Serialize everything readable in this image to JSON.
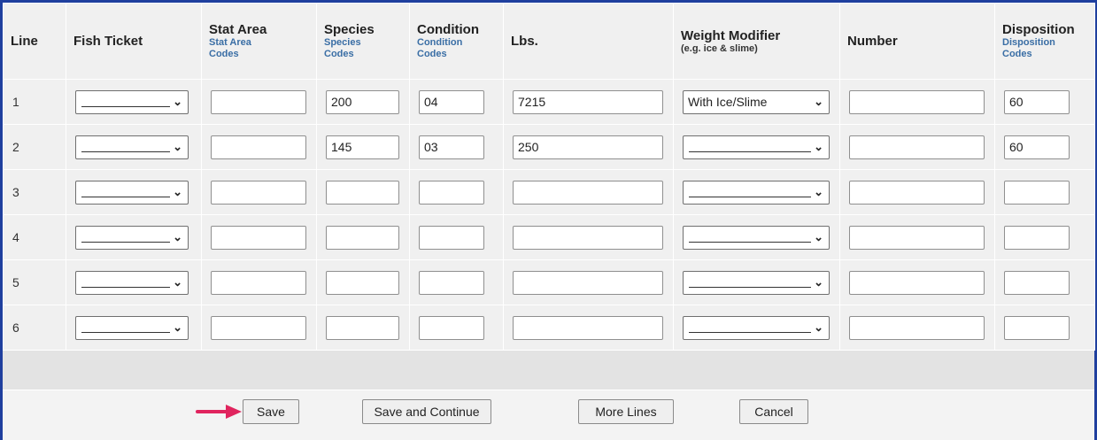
{
  "headers": {
    "line": "Line",
    "fish_ticket": "Fish Ticket",
    "stat_area": "Stat Area",
    "stat_area_link": "Stat Area Codes",
    "species": "Species",
    "species_link": "Species Codes",
    "condition": "Condition",
    "condition_link": "Condition Codes",
    "lbs": "Lbs.",
    "weight_modifier": "Weight Modifier",
    "weight_modifier_hint": "(e.g. ice & slime)",
    "number": "Number",
    "disposition": "Disposition",
    "disposition_link": "Disposition Codes"
  },
  "rows": [
    {
      "line": "1",
      "fish_ticket": "",
      "stat_area": "",
      "species": "200",
      "condition": "04",
      "lbs": "7215",
      "weight_modifier": "With Ice/Slime",
      "number": "",
      "disposition": "60"
    },
    {
      "line": "2",
      "fish_ticket": "",
      "stat_area": "",
      "species": "145",
      "condition": "03",
      "lbs": "250",
      "weight_modifier": "",
      "number": "",
      "disposition": "60"
    },
    {
      "line": "3",
      "fish_ticket": "",
      "stat_area": "",
      "species": "",
      "condition": "",
      "lbs": "",
      "weight_modifier": "",
      "number": "",
      "disposition": ""
    },
    {
      "line": "4",
      "fish_ticket": "",
      "stat_area": "",
      "species": "",
      "condition": "",
      "lbs": "",
      "weight_modifier": "",
      "number": "",
      "disposition": ""
    },
    {
      "line": "5",
      "fish_ticket": "",
      "stat_area": "",
      "species": "",
      "condition": "",
      "lbs": "",
      "weight_modifier": "",
      "number": "",
      "disposition": ""
    },
    {
      "line": "6",
      "fish_ticket": "",
      "stat_area": "",
      "species": "",
      "condition": "",
      "lbs": "",
      "weight_modifier": "",
      "number": "",
      "disposition": ""
    }
  ],
  "buttons": {
    "save": "Save",
    "save_continue": "Save and Continue",
    "more_lines": "More Lines",
    "cancel": "Cancel"
  },
  "icons": {
    "select_chevron": "chevron-down-icon",
    "pointer_arrow": "arrow-right-icon"
  },
  "colors": {
    "frame_border": "#1f3f9e",
    "link": "#3a6ea5",
    "arrow": "#e0245e"
  }
}
